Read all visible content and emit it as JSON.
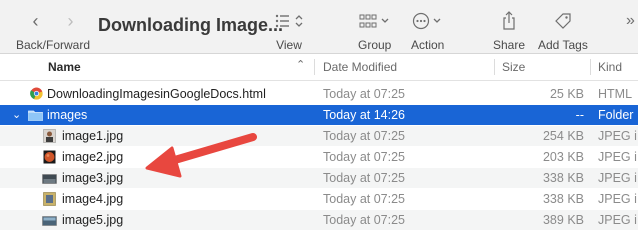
{
  "window": {
    "title": "Downloading Image..."
  },
  "toolbar": {
    "back_forward_label": "Back/Forward",
    "view_label": "View",
    "group_label": "Group",
    "action_label": "Action",
    "share_label": "Share",
    "add_tags_label": "Add Tags"
  },
  "columns": {
    "name": "Name",
    "date_modified": "Date Modified",
    "size": "Size",
    "kind": "Kind"
  },
  "files": [
    {
      "name": "DownloadingImagesinGoogleDocs.html",
      "date": "Today at 07:25",
      "size": "25 KB",
      "kind": "HTML",
      "icon": "chrome-html-icon"
    },
    {
      "name": "images",
      "date": "Today at 14:26",
      "size": "--",
      "kind": "Folder",
      "icon": "folder-icon"
    },
    {
      "name": "image1.jpg",
      "date": "Today at 07:25",
      "size": "254 KB",
      "kind": "JPEG i",
      "icon": "image-thumbnail-icon"
    },
    {
      "name": "image2.jpg",
      "date": "Today at 07:25",
      "size": "203 KB",
      "kind": "JPEG i",
      "icon": "image-thumbnail-icon"
    },
    {
      "name": "image3.jpg",
      "date": "Today at 07:25",
      "size": "338 KB",
      "kind": "JPEG i",
      "icon": "image-thumbnail-icon"
    },
    {
      "name": "image4.jpg",
      "date": "Today at 07:25",
      "size": "338 KB",
      "kind": "JPEG i",
      "icon": "image-thumbnail-icon"
    },
    {
      "name": "image5.jpg",
      "date": "Today at 07:25",
      "size": "389 KB",
      "kind": "JPEG i",
      "icon": "image-thumbnail-icon"
    }
  ],
  "colors": {
    "selection": "#1965d6",
    "annotation_arrow": "#e8473f"
  }
}
